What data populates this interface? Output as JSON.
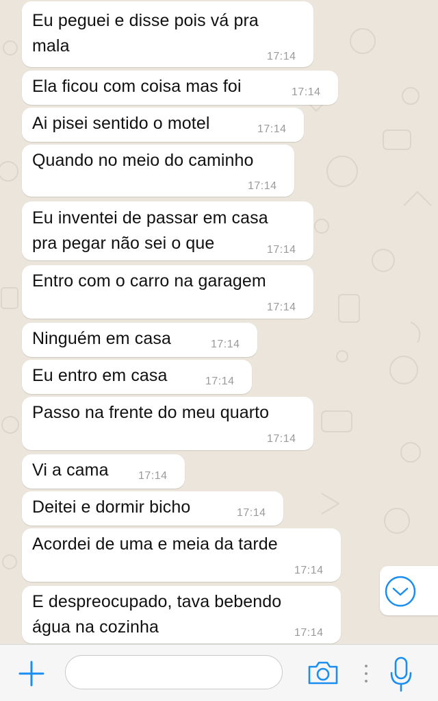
{
  "messages": [
    {
      "text": "Eu peguei e disse pois vá pra\nmala",
      "time": "17:14"
    },
    {
      "text": "Ela ficou com coisa mas foi",
      "time": "17:14"
    },
    {
      "text": "Ai pisei sentido o motel",
      "time": "17:14"
    },
    {
      "text": "Quando no meio do caminho",
      "time": "17:14"
    },
    {
      "text": "Eu inventei de passar em casa\npra pegar não sei o que",
      "time": "17:14"
    },
    {
      "text": "Entro com o carro na garagem",
      "time": "17:14"
    },
    {
      "text": "Ninguém em casa",
      "time": "17:14"
    },
    {
      "text": "Eu entro em casa",
      "time": "17:14"
    },
    {
      "text": "Passo na frente do meu quarto",
      "time": "17:14"
    },
    {
      "text": "Vi a cama",
      "time": "17:14"
    },
    {
      "text": "Deitei e dormir bicho",
      "time": "17:14"
    },
    {
      "text": "Acordei de uma e meia da tarde",
      "time": "17:14"
    },
    {
      "text": "E despreocupado, tava bebendo\nágua na cozinha",
      "time": "17:14"
    }
  ],
  "input": {
    "placeholder": "",
    "value": ""
  },
  "icons": {
    "attach": "plus-icon",
    "camera": "camera-icon",
    "more": "dots-icon",
    "mic": "microphone-icon",
    "scroll": "chevron-down-icon"
  },
  "colors": {
    "accent": "#1a8ef0",
    "bubble": "#ffffff",
    "wallpaper": "#ebe5dc",
    "timestamp": "#9a9a9a"
  }
}
